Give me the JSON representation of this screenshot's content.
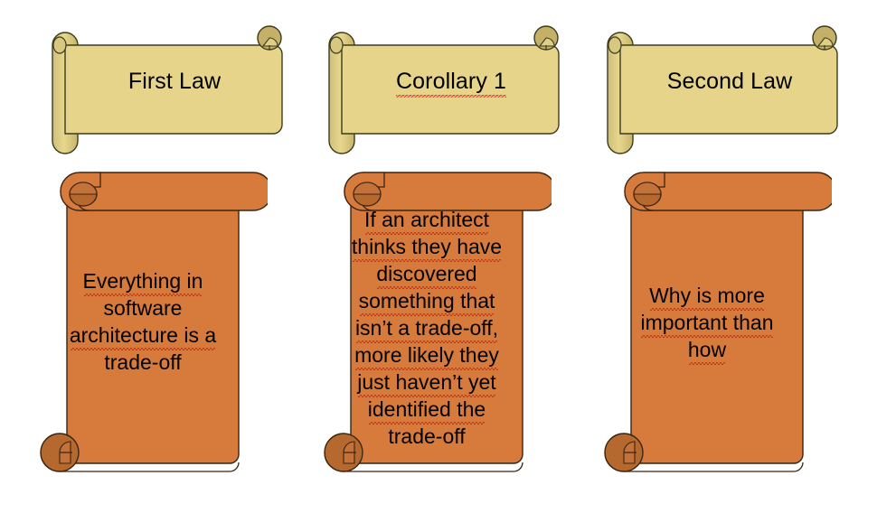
{
  "slide": {
    "background_color": "#FFFFFF",
    "theme": {
      "title_scroll_fill": "#E5D489",
      "title_scroll_curl": "#CBBA73",
      "title_scroll_outline": "#3B3B1E",
      "body_scroll_fill": "#D77B3C",
      "body_scroll_curl": "#B5692F",
      "body_scroll_outline": "#3A2412",
      "text_color": "#000000",
      "spellcheck_underline_color": "#D62B2B"
    }
  },
  "columns": [
    {
      "id": "first-law",
      "title": "First Law",
      "title_misspelled_words": [
        "Law"
      ],
      "body_lines": [
        "Everything in",
        "software",
        "architecture is a",
        "trade-off"
      ],
      "body_text": "Everything in software architecture is a trade-off"
    },
    {
      "id": "corollary-1",
      "title": "Corollary 1",
      "title_misspelled_words": [
        "Corollary"
      ],
      "body_lines": [
        "If an architect",
        "thinks they have",
        "discovered",
        "something that",
        "isn’t a trade-off,",
        "more likely they",
        "just haven’t yet",
        "identified the",
        "trade-off"
      ],
      "body_text": "If an architect thinks they have discovered something that isn’t a trade-off, more likely they just haven’t yet identified the trade-off"
    },
    {
      "id": "second-law",
      "title": "Second Law",
      "title_misspelled_words": [
        "Law"
      ],
      "body_lines": [
        "Why is more",
        "important than",
        "how"
      ],
      "body_text": "Why is more important than how"
    }
  ]
}
